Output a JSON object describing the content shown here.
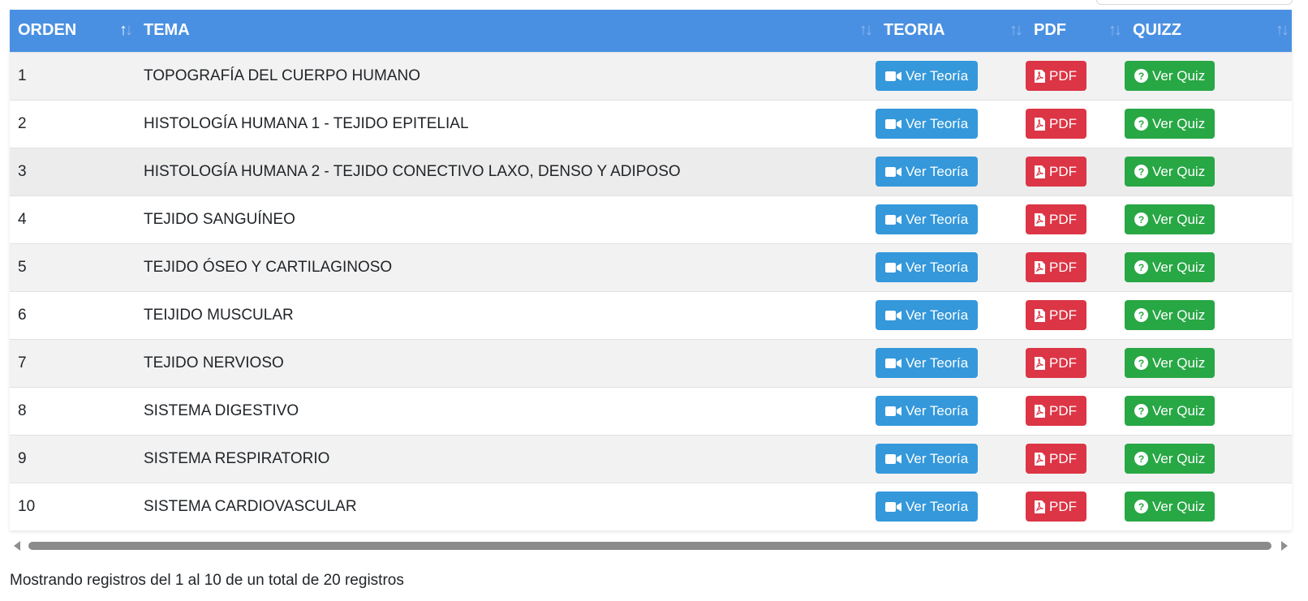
{
  "table": {
    "columns": [
      {
        "key": "orden",
        "label": "ORDEN",
        "sort_active": true
      },
      {
        "key": "tema",
        "label": "TEMA",
        "sort_active": false
      },
      {
        "key": "teoria",
        "label": "TEORIA",
        "sort_active": false
      },
      {
        "key": "pdf",
        "label": "PDF",
        "sort_active": false
      },
      {
        "key": "quizz",
        "label": "QUIZZ",
        "sort_active": false
      }
    ],
    "buttons": {
      "teoria_label": "Ver Teoría",
      "pdf_label": "PDF",
      "quiz_label": "Ver Quiz"
    },
    "rows": [
      {
        "orden": "1",
        "tema": "TOPOGRAFÍA DEL CUERPO HUMANO"
      },
      {
        "orden": "2",
        "tema": "HISTOLOGÍA HUMANA 1 - TEJIDO EPITELIAL"
      },
      {
        "orden": "3",
        "tema": "HISTOLOGÍA HUMANA 2 - TEJIDO CONECTIVO LAXO, DENSO Y ADIPOSO"
      },
      {
        "orden": "4",
        "tema": "TEJIDO SANGUÍNEO"
      },
      {
        "orden": "5",
        "tema": "TEJIDO ÓSEO Y CARTILAGINOSO"
      },
      {
        "orden": "6",
        "tema": "TEIJIDO MUSCULAR"
      },
      {
        "orden": "7",
        "tema": "TEJIDO NERVIOSO"
      },
      {
        "orden": "8",
        "tema": "SISTEMA DIGESTIVO"
      },
      {
        "orden": "9",
        "tema": "SISTEMA RESPIRATORIO"
      },
      {
        "orden": "10",
        "tema": "SISTEMA CARDIOVASCULAR"
      }
    ]
  },
  "footer": {
    "info": "Mostrando registros del 1 al 10 de un total de 20 registros"
  },
  "icons": {
    "sort": "sort-arrows-icon",
    "teoria": "video-camera-icon",
    "pdf": "file-pdf-icon",
    "quiz": "question-circle-icon"
  },
  "colors": {
    "header": "#4a90e2",
    "teoria_button": "#3498db",
    "pdf_button": "#dc3545",
    "quiz_button": "#28a745"
  }
}
